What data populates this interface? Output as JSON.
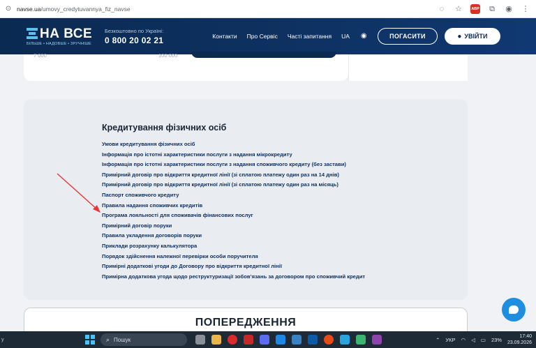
{
  "browser": {
    "url_host": "navse.ua",
    "url_path": "/umovy_credytuvannya_fiz_navse",
    "extension_badge": "ABP"
  },
  "header": {
    "logo_text": "НА ВСЕ",
    "logo_tagline": "БІЛЬШЕ • НАДОВШЕ • ЗРУЧНІШЕ",
    "phone_label": "Безкоштовно по Україні:",
    "phone_number": "0 800 20 02 21",
    "nav": [
      "Контакти",
      "Про Сервіс",
      "Часті запитання",
      "UA"
    ],
    "pay_button": "ПОГАСИТИ",
    "login_button": "УВІЙТИ"
  },
  "calculator": {
    "min_value": "7 000",
    "max_value": "100 000"
  },
  "docs": {
    "title": "Кредитування фізичних осіб",
    "items": [
      "Умови кредитування фізичних осіб",
      "Інформація про істотні характеристики послуги з надання мікрокредиту",
      "Інформація про істотні характеристики послуги з надання споживчого кредиту (без застави)",
      "Примірний договір про відкриття кредитної лінії (зі сплатою платежу один раз на 14 днів)",
      "Примірний договір про відкриття кредитної лінії (зі сплатою платежу один раз на місяць)",
      "Паспорт споживчого кредиту",
      "Правила надання споживчих кредитів",
      "Програма лояльності для споживачів фінансових послуг",
      "Примірний договір поруки",
      "Правила укладення договорів поруки",
      "Приклади розрахунку калькулятора",
      "Порядок здійснення належної перевірки особи поручителя",
      "Примірні додаткові угоди до Договору про відкриття кредитної лінії",
      "Примірна додаткова угода щодо реструктуризації зобов’язань за договором про споживчий кредит"
    ]
  },
  "warning": {
    "title": "ПОПЕРЕДЖЕННЯ"
  },
  "taskbar": {
    "left_edge": "у",
    "search_placeholder": "Пошук",
    "language": "УКР",
    "battery": "23%",
    "time": "17:40",
    "date": "23.09.2026"
  },
  "colors": {
    "header_bg": "#0e3263",
    "accent_blue": "#1f8de0",
    "link_navy": "#0d2e5c",
    "annotation_red": "#e53935"
  }
}
